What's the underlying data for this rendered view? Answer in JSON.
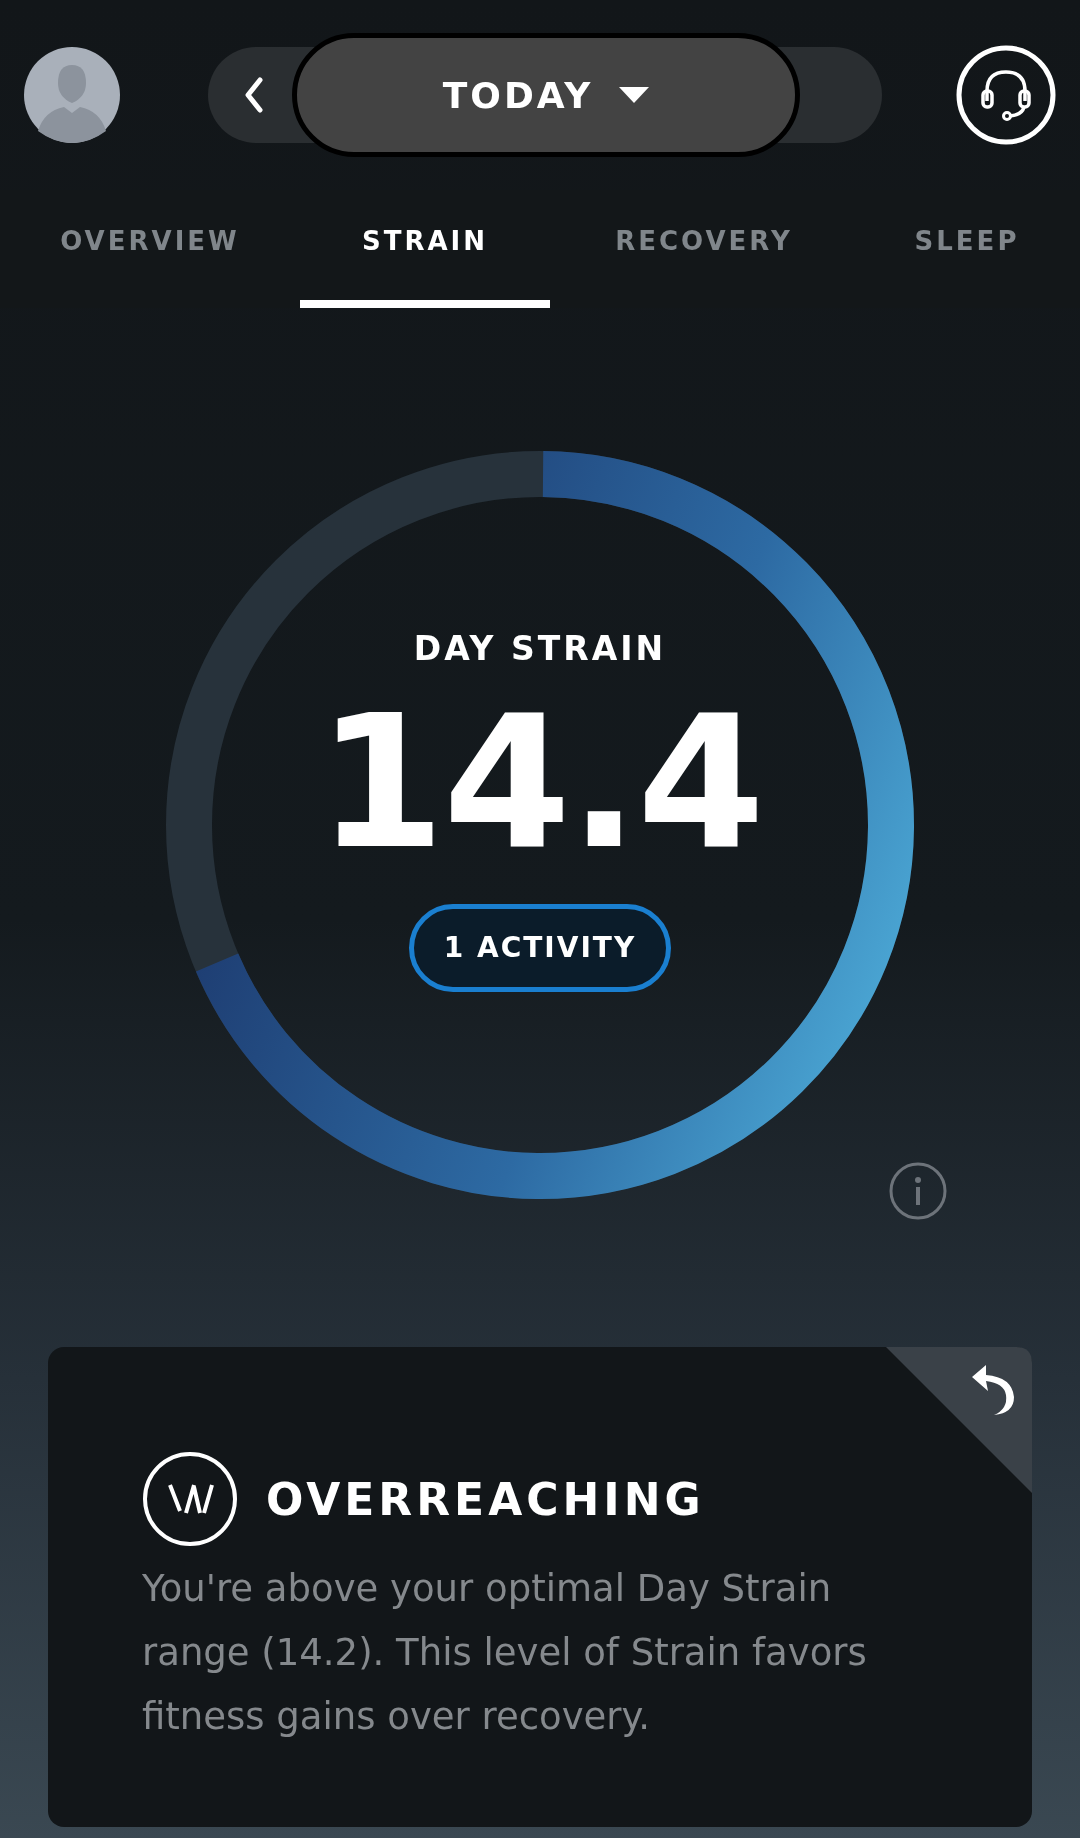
{
  "header": {
    "date_label": "TODAY"
  },
  "tabs": [
    {
      "label": "OVERVIEW",
      "selected": false
    },
    {
      "label": "STRAIN",
      "selected": true
    },
    {
      "label": "RECOVERY",
      "selected": false
    },
    {
      "label": "SLEEP",
      "selected": false
    }
  ],
  "gauge": {
    "title": "DAY STRAIN",
    "value": "14.4",
    "level": 0.686,
    "activity_button": "1 ACTIVITY"
  },
  "card": {
    "title": "OVERREACHING",
    "body": "You're above your optimal Day Strain range (14.2). This level of Strain favors fitness gains over recovery."
  }
}
